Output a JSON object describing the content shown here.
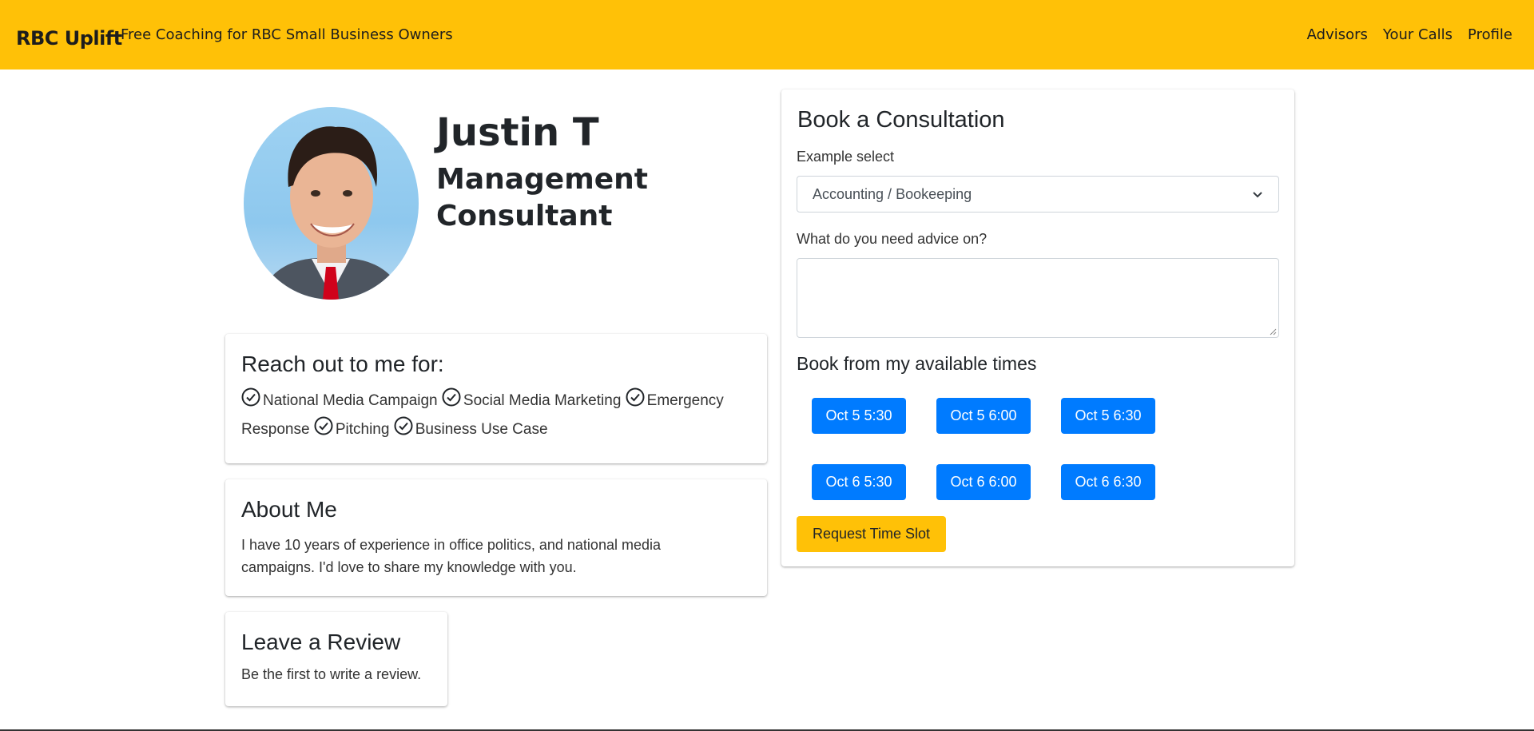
{
  "navbar": {
    "brand": "RBC Uplift",
    "tagline": "Free Coaching for RBC Small Business Owners",
    "links": [
      "Advisors",
      "Your Calls",
      "Profile"
    ]
  },
  "profile": {
    "name": "Justin T",
    "title": "Management Consultant",
    "avatar_icon": "advisor-portrait"
  },
  "reach": {
    "heading": "Reach out to me for:",
    "tags": [
      "National Media Campaign",
      "Social Media Marketing",
      "Emergency Response",
      "Pitching",
      "Business Use Case"
    ]
  },
  "about": {
    "heading": "About Me",
    "text": "I have 10 years of experience in office politics, and national media campaigns. I'd love to share my knowledge with you."
  },
  "review": {
    "heading": "Leave a Review",
    "text": "Be the first to write a review."
  },
  "booking": {
    "heading": "Book a Consultation",
    "select_label": "Example select",
    "select_value": "Accounting / Bookeeping",
    "advice_label": "What do you need advice on?",
    "advice_value": "",
    "times_heading": "Book from my available times",
    "times": [
      "Oct 5 5:30",
      "Oct 5 6:00",
      "Oct 5 6:30",
      "Oct 6 5:30",
      "Oct 6 6:00",
      "Oct 6 6:30"
    ],
    "request_label": "Request Time Slot"
  },
  "colors": {
    "accent": "#ffc107",
    "primary": "#007bff"
  }
}
